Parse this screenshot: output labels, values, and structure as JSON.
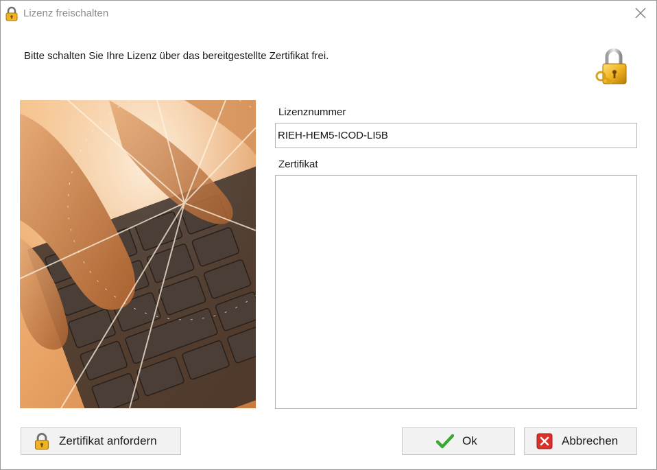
{
  "window": {
    "title": "Lizenz freischalten",
    "icons": {
      "title": "padlock-icon",
      "close": "close-icon",
      "header": "padlock-keys-icon"
    }
  },
  "instruction": "Bitte schalten Sie Ihre Lizenz über das bereitgestellte Zertifikat frei.",
  "image": {
    "description_icon": "keyboard-photo"
  },
  "license": {
    "label": "Lizenznummer",
    "value": "RIEH-HEM5-ICOD-LI5B"
  },
  "certificate": {
    "label": "Zertifikat",
    "value": ""
  },
  "buttons": {
    "request_certificate": {
      "label": "Zertifikat anfordern",
      "icon": "padlock-icon"
    },
    "ok": {
      "label": "Ok",
      "icon": "checkmark-icon",
      "icon_color": "#3aa832"
    },
    "cancel": {
      "label": "Abbrechen",
      "icon": "cancel-x-icon",
      "icon_color": "#d9302a"
    }
  },
  "colors": {
    "accent_lock": "#e8a317",
    "photo_tint": "#d98a3c"
  }
}
